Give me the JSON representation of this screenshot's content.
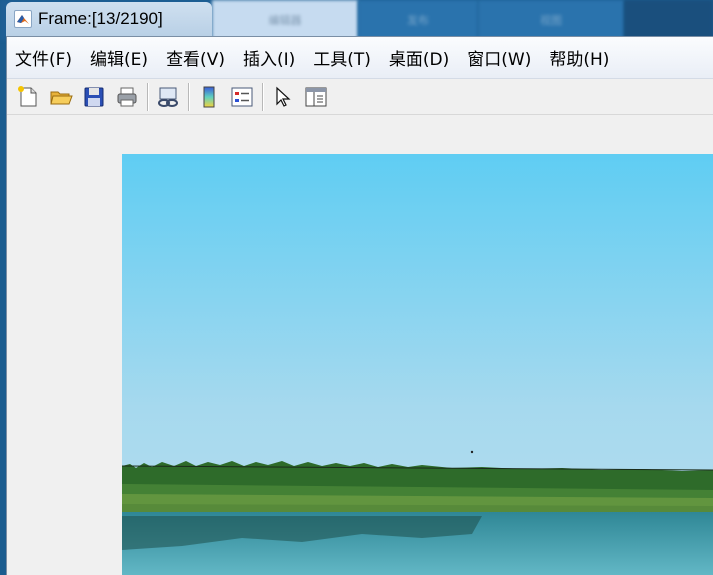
{
  "window": {
    "title": "Frame:[13/2190]"
  },
  "background_tabs": [
    {
      "label": "编辑器"
    },
    {
      "label": "发布"
    },
    {
      "label": "视图"
    }
  ],
  "menubar": {
    "items": [
      {
        "label": "文件(F)"
      },
      {
        "label": "编辑(E)"
      },
      {
        "label": "查看(V)"
      },
      {
        "label": "插入(I)"
      },
      {
        "label": "工具(T)"
      },
      {
        "label": "桌面(D)"
      },
      {
        "label": "窗口(W)"
      },
      {
        "label": "帮助(H)"
      }
    ]
  },
  "toolbar": {
    "buttons": [
      {
        "icon": "new-figure-icon"
      },
      {
        "icon": "open-file-icon"
      },
      {
        "icon": "save-icon"
      },
      {
        "icon": "print-icon"
      },
      {
        "icon": "link-plot-icon"
      },
      {
        "icon": "insert-colorbar-icon"
      },
      {
        "icon": "insert-legend-icon"
      },
      {
        "icon": "edit-plot-icon"
      },
      {
        "icon": "property-inspector-icon"
      }
    ]
  },
  "content": {
    "image_description_colors": {
      "sky_top": "#5fcdf3",
      "sky_mid": "#a6d9ee",
      "treeline": "#2e6b2a",
      "water": "#3f9fb3"
    }
  }
}
